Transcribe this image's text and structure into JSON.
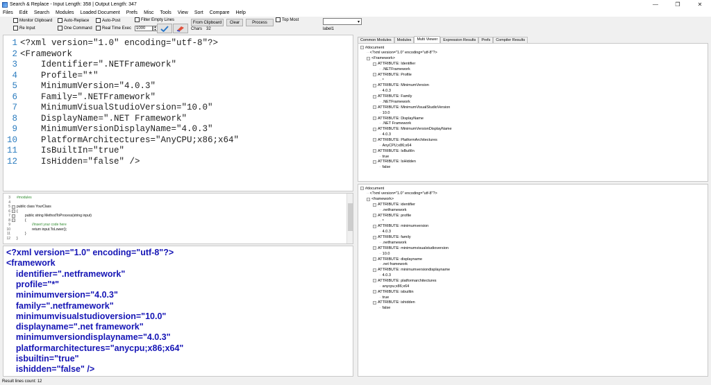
{
  "window": {
    "title": "Search & Replace - Input Length: 358 | Output Length: 347"
  },
  "menu": [
    "Files",
    "Edit",
    "Search",
    "Modules",
    "Loaded Document",
    "Prefs",
    "Misc",
    "Tools",
    "View",
    "Sort",
    "Compare",
    "Help"
  ],
  "toolbar": {
    "monitor_clipboard": "Monitor Clipboard",
    "re_input": "Re Input",
    "auto_replace": "Auto-Replace",
    "one_command": "One Command",
    "auto_post": "Auto-Post",
    "real_time_exec": "Real Time Exec",
    "interval_value": "1000",
    "filter_empty_lines": "Filter Empty Lines",
    "chars_label": "Chars",
    "chars_value": "32",
    "from_clipboard": "From Clipboard",
    "clear": "Clear",
    "process": "Process",
    "top_most": "Top Most",
    "label1": "label1"
  },
  "editor_lines": [
    {
      "n": "1",
      "text": "<?xml version=\"1.0\" encoding=\"utf-8\"?>"
    },
    {
      "n": "2",
      "text": "<Framework"
    },
    {
      "n": "3",
      "text": "    Identifier=\".NETFramework\""
    },
    {
      "n": "4",
      "text": "    Profile=\"*\""
    },
    {
      "n": "5",
      "text": "    MinimumVersion=\"4.0.3\""
    },
    {
      "n": "6",
      "text": "    Family=\".NETFramework\""
    },
    {
      "n": "7",
      "text": "    MinimumVisualStudioVersion=\"10.0\""
    },
    {
      "n": "8",
      "text": "    DisplayName=\".NET Framework\""
    },
    {
      "n": "9",
      "text": "    MinimumVersionDisplayName=\"4.0.3\""
    },
    {
      "n": "10",
      "text": "    PlatformArchitectures=\"AnyCPU;x86;x64\""
    },
    {
      "n": "11",
      "text": "    IsBuiltIn=\"true\""
    },
    {
      "n": "12",
      "text": "    IsHidden=\"false\" />"
    }
  ],
  "code_lines": [
    {
      "n": "3",
      "text": "#modules",
      "color": "#2e8b2e",
      "indent": 0
    },
    {
      "n": "4",
      "text": "",
      "color": "#000",
      "indent": 0
    },
    {
      "n": "5",
      "text": "public class YourClass",
      "color": "#000",
      "indent": 0
    },
    {
      "n": "6",
      "text": "{",
      "color": "#000",
      "indent": 0
    },
    {
      "n": "7",
      "text": "public string MethodToProcess(string input)",
      "color": "#000",
      "indent": 12
    },
    {
      "n": "8",
      "text": "{",
      "color": "#000",
      "indent": 12
    },
    {
      "n": "9",
      "text": "//insert your code here",
      "color": "#2e8b2e",
      "indent": 22
    },
    {
      "n": "10",
      "text": "return input.ToLower();",
      "color": "#000",
      "indent": 22
    },
    {
      "n": "11",
      "text": "}",
      "color": "#000",
      "indent": 12
    },
    {
      "n": "12",
      "text": "}",
      "color": "#000",
      "indent": 0
    }
  ],
  "result_lines": [
    "<?xml version=\"1.0\" encoding=\"utf-8\"?>",
    "<framework",
    "    identifier=\".netframework\"",
    "    profile=\"*\"",
    "    minimumversion=\"4.0.3\"",
    "    family=\".netframework\"",
    "    minimumvisualstudioversion=\"10.0\"",
    "    displayname=\".net framework\"",
    "    minimumversiondisplayname=\"4.0.3\"",
    "    platformarchitectures=\"anycpu;x86;x64\"",
    "    isbuiltin=\"true\"",
    "    ishidden=\"false\" />"
  ],
  "status": "Result lines count: 12",
  "tabs": [
    "Common Modules",
    "Modules",
    "Multi Viewer",
    "Expression Results",
    "Prefs",
    "Compiler Results"
  ],
  "active_tab": "Multi Viewer",
  "tree_top": [
    {
      "d": 0,
      "t": "#document",
      "tog": "−"
    },
    {
      "d": 1,
      "t": "<?xml version=\"1.0\" encoding=\"utf-8\"?>"
    },
    {
      "d": 1,
      "t": "<Framework>",
      "tog": "−"
    },
    {
      "d": 2,
      "t": "ATTRIBUTE: Identifier",
      "tog": "−"
    },
    {
      "d": 3,
      "t": ".NETFramework"
    },
    {
      "d": 2,
      "t": "ATTRIBUTE: Profile",
      "tog": "−"
    },
    {
      "d": 3,
      "t": "*"
    },
    {
      "d": 2,
      "t": "ATTRIBUTE: MinimumVersion",
      "tog": "−"
    },
    {
      "d": 3,
      "t": "4.0.3"
    },
    {
      "d": 2,
      "t": "ATTRIBUTE: Family",
      "tog": "−"
    },
    {
      "d": 3,
      "t": ".NETFramework"
    },
    {
      "d": 2,
      "t": "ATTRIBUTE: MinimumVisualStudioVersion",
      "tog": "−"
    },
    {
      "d": 3,
      "t": "10.0"
    },
    {
      "d": 2,
      "t": "ATTRIBUTE: DisplayName",
      "tog": "−"
    },
    {
      "d": 3,
      "t": ".NET Framework"
    },
    {
      "d": 2,
      "t": "ATTRIBUTE: MinimumVersionDisplayName",
      "tog": "−"
    },
    {
      "d": 3,
      "t": "4.0.3"
    },
    {
      "d": 2,
      "t": "ATTRIBUTE: PlatformArchitectures",
      "tog": "−"
    },
    {
      "d": 3,
      "t": "AnyCPU;x86;x64"
    },
    {
      "d": 2,
      "t": "ATTRIBUTE: IsBuiltIn",
      "tog": "−"
    },
    {
      "d": 3,
      "t": "true"
    },
    {
      "d": 2,
      "t": "ATTRIBUTE: IsHidden",
      "tog": "−"
    },
    {
      "d": 3,
      "t": "false"
    }
  ],
  "tree_bottom": [
    {
      "d": 0,
      "t": "#document",
      "tog": "−"
    },
    {
      "d": 1,
      "t": "<?xml version=\"1.0\" encoding=\"utf-8\"?>"
    },
    {
      "d": 1,
      "t": "<framework>",
      "tog": "−"
    },
    {
      "d": 2,
      "t": "ATTRIBUTE: identifier",
      "tog": "−"
    },
    {
      "d": 3,
      "t": ".netframework"
    },
    {
      "d": 2,
      "t": "ATTRIBUTE: profile",
      "tog": "−"
    },
    {
      "d": 3,
      "t": "*"
    },
    {
      "d": 2,
      "t": "ATTRIBUTE: minimumversion",
      "tog": "−"
    },
    {
      "d": 3,
      "t": "4.0.3"
    },
    {
      "d": 2,
      "t": "ATTRIBUTE: family",
      "tog": "−"
    },
    {
      "d": 3,
      "t": ".netframework"
    },
    {
      "d": 2,
      "t": "ATTRIBUTE: minimumvisualstudioversion",
      "tog": "−"
    },
    {
      "d": 3,
      "t": "10.0"
    },
    {
      "d": 2,
      "t": "ATTRIBUTE: displayname",
      "tog": "−"
    },
    {
      "d": 3,
      "t": ".net framework"
    },
    {
      "d": 2,
      "t": "ATTRIBUTE: minimumversiondisplayname",
      "tog": "−"
    },
    {
      "d": 3,
      "t": "4.0.3"
    },
    {
      "d": 2,
      "t": "ATTRIBUTE: platformarchitectures",
      "tog": "−"
    },
    {
      "d": 3,
      "t": "anycpu;x86;x64"
    },
    {
      "d": 2,
      "t": "ATTRIBUTE: isbuiltin",
      "tog": "−"
    },
    {
      "d": 3,
      "t": "true"
    },
    {
      "d": 2,
      "t": "ATTRIBUTE: ishidden",
      "tog": "−"
    },
    {
      "d": 3,
      "t": "false"
    }
  ],
  "colors": {
    "line_numbers": "#2b7cbf",
    "result_text": "#1515b5",
    "comment": "#2e8b2e"
  }
}
